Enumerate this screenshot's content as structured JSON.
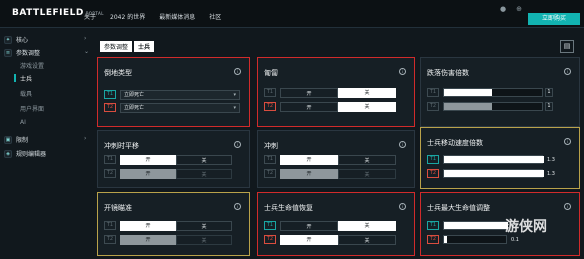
{
  "topbar": {
    "logo": "BATTLEFIELD",
    "logo_sub": "PORTAL",
    "nav": [
      "关于",
      "2042 的世界",
      "最新媒体消息",
      "社区"
    ],
    "cta": "立即购买"
  },
  "sidebar": {
    "items": [
      {
        "label": "核心",
        "icon": "core-icon"
      },
      {
        "label": "参数调整",
        "icon": "tune-icon"
      },
      {
        "label": "限制",
        "icon": "restrict-icon"
      },
      {
        "label": "规则编辑器",
        "icon": "rules-icon"
      }
    ],
    "sub_items": [
      "游戏设置",
      "士兵",
      "载具",
      "用户界面",
      "AI"
    ]
  },
  "breadcrumb": {
    "parent": "参数调整",
    "current": "士兵"
  },
  "labels": {
    "t1": "T1",
    "t2": "T2",
    "on": "开",
    "off": "关",
    "info": "i"
  },
  "cards": {
    "fall_type": {
      "title": "倒地类型",
      "t1_value": "立即死亡",
      "t2_value": "立即死亡"
    },
    "crouch": {
      "title": "匍匐"
    },
    "fall_damage": {
      "title": "跌落伤害倍数",
      "t1_value": "1",
      "t2_value": "1"
    },
    "sprint_mod": {
      "title": "冲刺时平移"
    },
    "sprint": {
      "title": "冲刺"
    },
    "move_speed": {
      "title": "士兵移动速度倍数",
      "t1_value": "1.3",
      "t2_value": "1.3"
    },
    "aim_down": {
      "title": "开镜瞄准"
    },
    "regen": {
      "title": "士兵生命值恢复"
    },
    "max_hp": {
      "title": "士兵最大生命值调整",
      "t1_value": "5",
      "t2_value": "0.1"
    }
  },
  "watermark": "游侠网",
  "colors": {
    "accent": "#12b3b1",
    "highlight_red": "#d12b2b",
    "highlight_yellow": "#b9a24a"
  }
}
